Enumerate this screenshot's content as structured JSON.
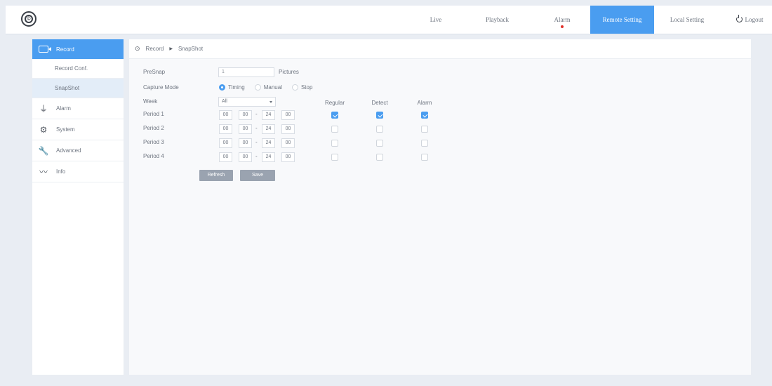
{
  "topnav": {
    "items": [
      {
        "label": "Live"
      },
      {
        "label": "Playback"
      },
      {
        "label": "Alarm"
      },
      {
        "label": "Remote Setting"
      },
      {
        "label": "Local Setting"
      },
      {
        "label": "Logout"
      }
    ],
    "active": "Remote Setting",
    "accent": "#4a9df0",
    "alarm_dot_color": "#e0302a"
  },
  "sidebar": {
    "items": [
      {
        "label": "Record",
        "icon": "record-icon"
      },
      {
        "label": "Record Conf."
      },
      {
        "label": "SnapShot"
      },
      {
        "label": "Alarm",
        "icon": "alarm-icon"
      },
      {
        "label": "System",
        "icon": "system-icon"
      },
      {
        "label": "Advanced",
        "icon": "wrench-icon"
      },
      {
        "label": "Info",
        "icon": "info-icon"
      }
    ],
    "active": "Record",
    "selected_sub": "SnapShot"
  },
  "breadcrumb": {
    "items": [
      "Record",
      "SnapShot"
    ]
  },
  "form": {
    "presnap": {
      "label": "PreSnap",
      "value": "1",
      "unit": "Pictures"
    },
    "capture_mode": {
      "label": "Capture Mode",
      "options": [
        "Timing",
        "Manual",
        "Stop"
      ],
      "selected": "Timing"
    },
    "week": {
      "label": "Week",
      "value": "All"
    },
    "columns": [
      "Regular",
      "Detect",
      "Alarm"
    ],
    "periods": [
      {
        "label": "Period 1",
        "start_h": "00",
        "start_m": "00",
        "end_h": "24",
        "end_m": "00",
        "regular": true,
        "detect": true,
        "alarm": true
      },
      {
        "label": "Period 2",
        "start_h": "00",
        "start_m": "00",
        "end_h": "24",
        "end_m": "00",
        "regular": false,
        "detect": false,
        "alarm": false
      },
      {
        "label": "Period 3",
        "start_h": "00",
        "start_m": "00",
        "end_h": "24",
        "end_m": "00",
        "regular": false,
        "detect": false,
        "alarm": false
      },
      {
        "label": "Period 4",
        "start_h": "00",
        "start_m": "00",
        "end_h": "24",
        "end_m": "00",
        "regular": false,
        "detect": false,
        "alarm": false
      }
    ],
    "separator": "-",
    "refresh_label": "Refresh",
    "save_label": "Save"
  }
}
